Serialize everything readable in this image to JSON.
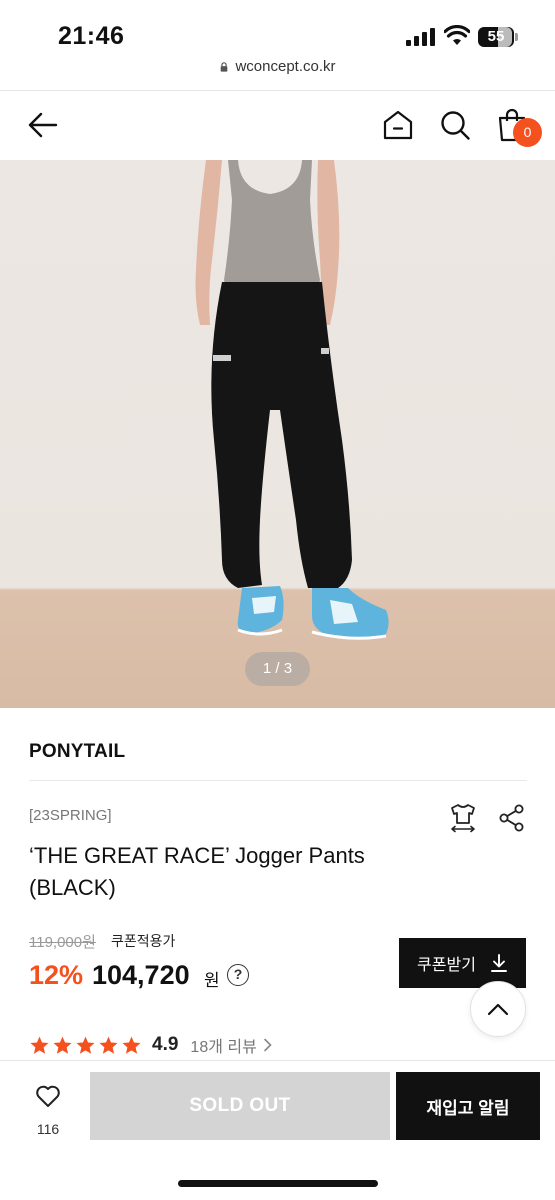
{
  "status": {
    "time": "21:46",
    "battery": "55"
  },
  "browser": {
    "url": "wconcept.co.kr"
  },
  "header": {
    "cart_count": "0"
  },
  "gallery": {
    "pager": "1 / 3",
    "current": 1,
    "total": 3
  },
  "product": {
    "brand": "PONYTAIL",
    "season": "[23SPRING]",
    "title": "‘THE GREAT RACE’ Jogger Pants (BLACK)",
    "original_price": "119,000원",
    "coupon_note": "쿠폰적용가",
    "discount": "12%",
    "price": "104,720",
    "currency": "원",
    "help": "?",
    "coupon_button": "쿠폰받기",
    "rating": "4.9",
    "rating_value": 4.9,
    "reviews": "18개 리뷰"
  },
  "bottom": {
    "likes": "116",
    "soldout": "SOLD OUT",
    "restock": "재입고 알림"
  },
  "colors": {
    "accent": "#f4511e",
    "dark": "#111111",
    "soldout_bg": "#d4d4d4"
  },
  "icons": [
    "back-arrow-icon",
    "home-icon",
    "search-icon",
    "shopping-bag-icon",
    "size-guide-icon",
    "share-icon",
    "download-icon",
    "chevron-up-icon",
    "star-icon",
    "chevron-right-icon",
    "heart-icon",
    "lock-icon"
  ]
}
